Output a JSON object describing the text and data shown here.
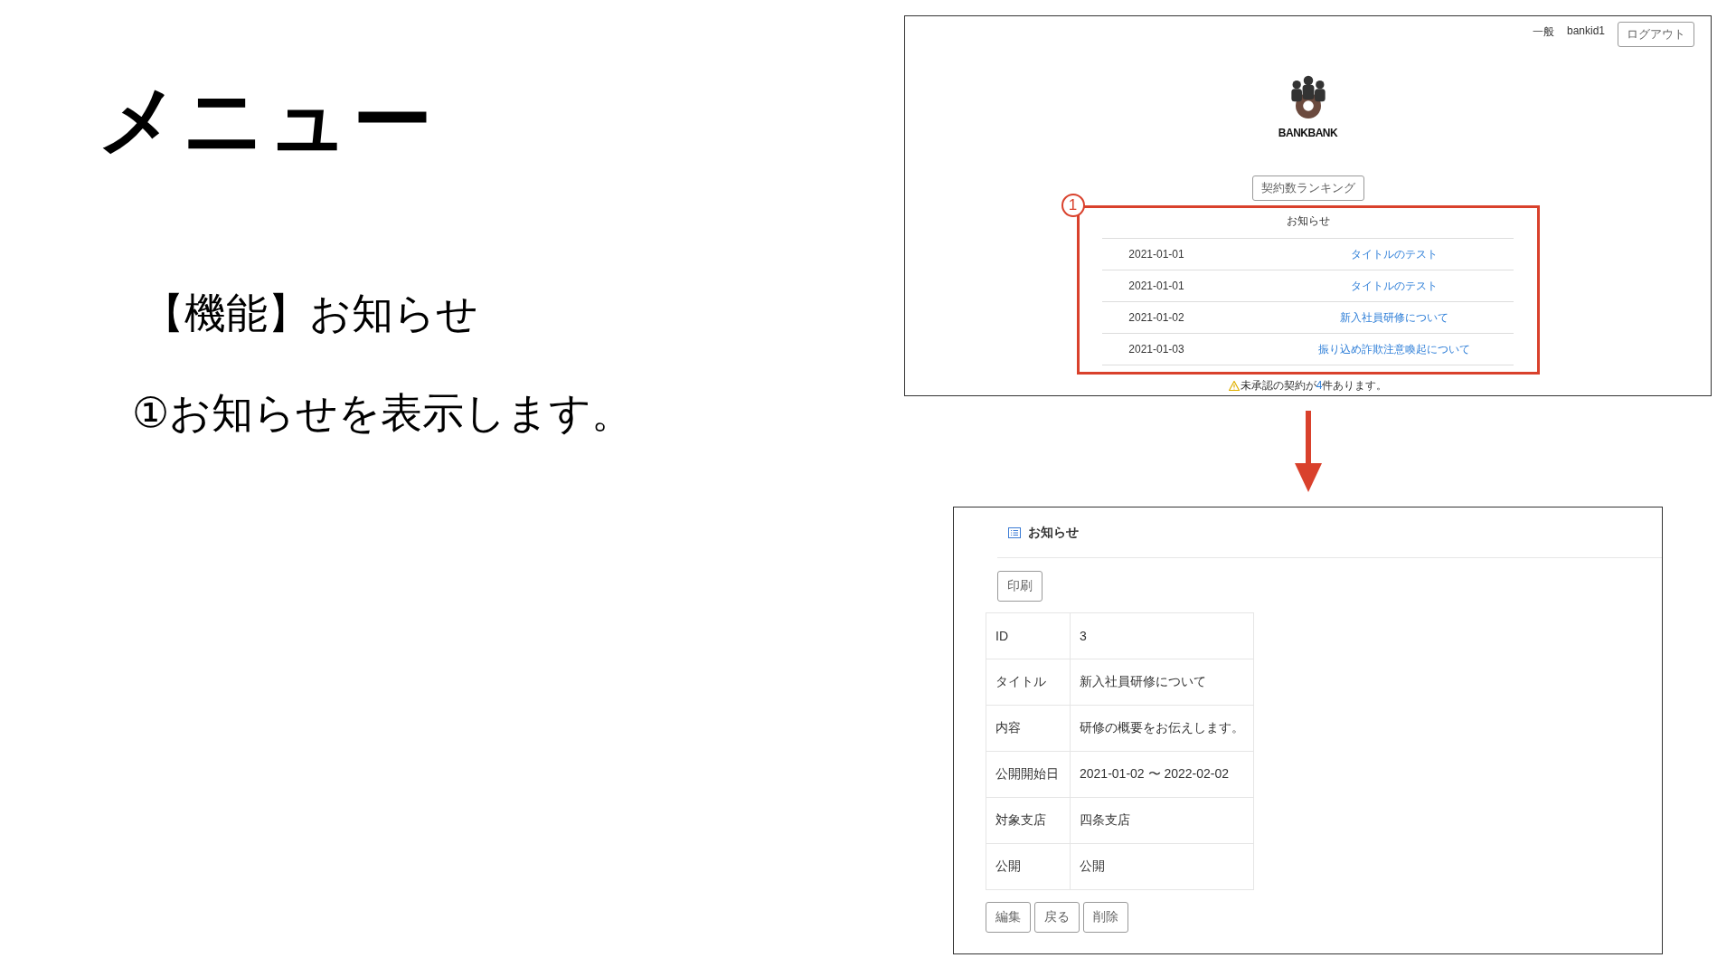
{
  "slide": {
    "title": "メニュー",
    "feature": "【機能】お知らせ",
    "description": "①お知らせを表示します。"
  },
  "top_screen": {
    "user_role": "一般",
    "user_name": "bankid1",
    "logout_button": "ログアウト",
    "logo_text": "BANKBANK",
    "ranking_button": "契約数ランキング",
    "annotation": {
      "number": "1"
    },
    "notices": {
      "heading": "お知らせ",
      "rows": [
        {
          "date": "2021-01-01",
          "title": "タイトルのテスト"
        },
        {
          "date": "2021-01-01",
          "title": "タイトルのテスト"
        },
        {
          "date": "2021-01-02",
          "title": "新入社員研修について"
        },
        {
          "date": "2021-01-03",
          "title": "振り込め詐欺注意喚起について"
        }
      ]
    },
    "alert": {
      "before": "未承認の契約が",
      "count": "4",
      "after": "件あります。"
    }
  },
  "detail_screen": {
    "title": "お知らせ",
    "print_button": "印刷",
    "fields": [
      {
        "label": "ID",
        "value": "3"
      },
      {
        "label": "タイトル",
        "value": "新入社員研修について"
      },
      {
        "label": "内容",
        "value": "研修の概要をお伝えします。"
      },
      {
        "label": "公開開始日",
        "value": "2021-01-02 〜 2022-02-02"
      },
      {
        "label": "対象支店",
        "value": "四条支店"
      },
      {
        "label": "公開",
        "value": "公開"
      }
    ],
    "buttons": [
      "編集",
      "戻る",
      "削除"
    ]
  }
}
